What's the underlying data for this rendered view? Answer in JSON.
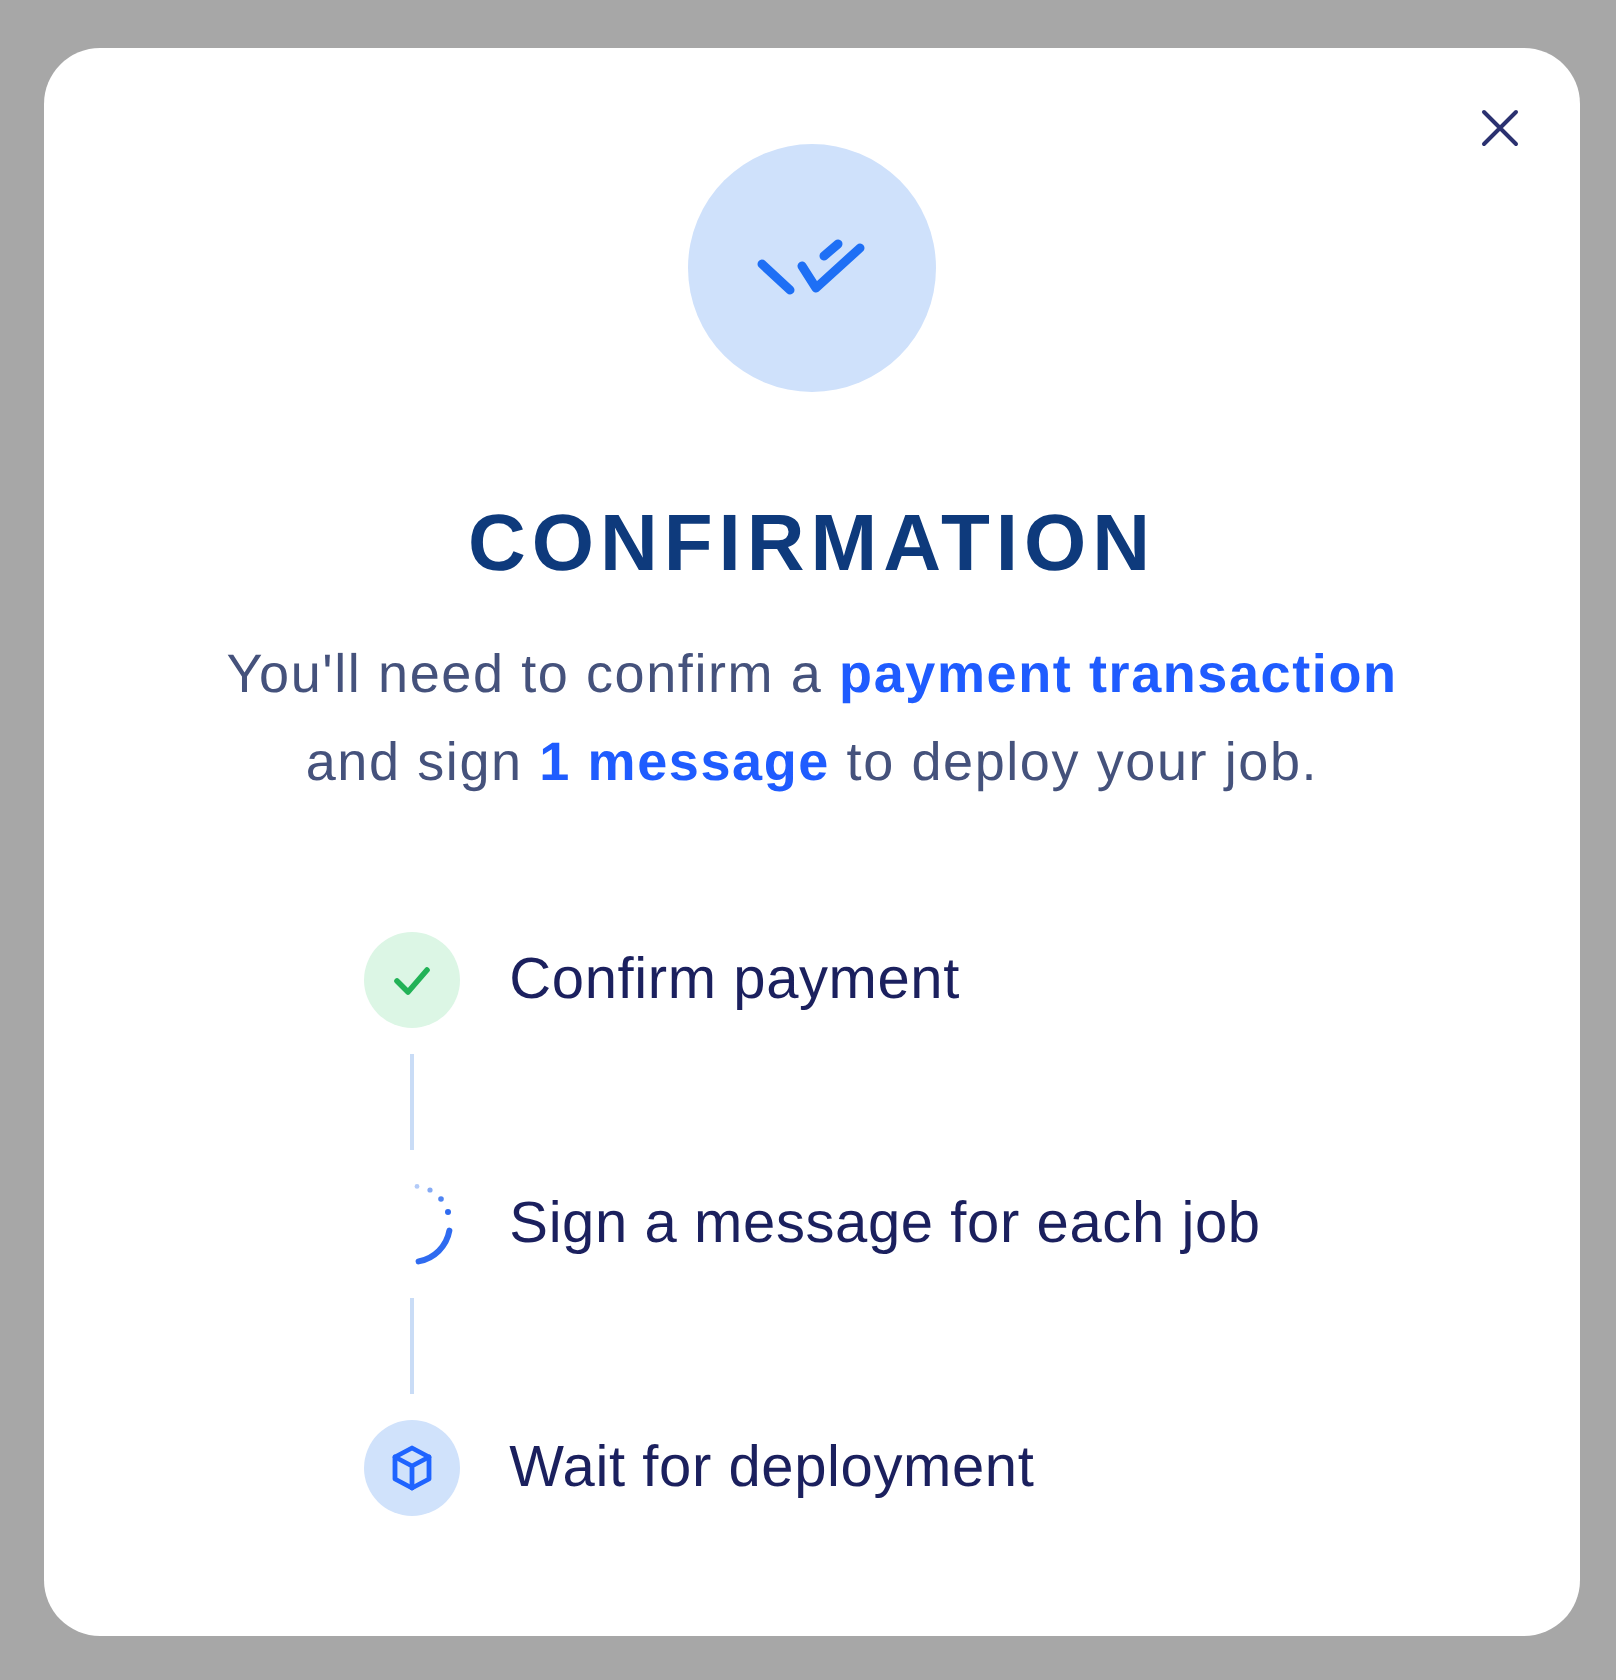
{
  "dialog": {
    "title": "CONFIRMATION",
    "description": "You'll need to confirm a **payment transaction**\nand sign **1 message** to deploy your job."
  },
  "steps": [
    {
      "label": "Confirm payment",
      "kind": "done"
    },
    {
      "label": "Sign a message for each job",
      "kind": "active"
    },
    {
      "label": "Wait for deployment",
      "kind": "pending"
    }
  ]
}
